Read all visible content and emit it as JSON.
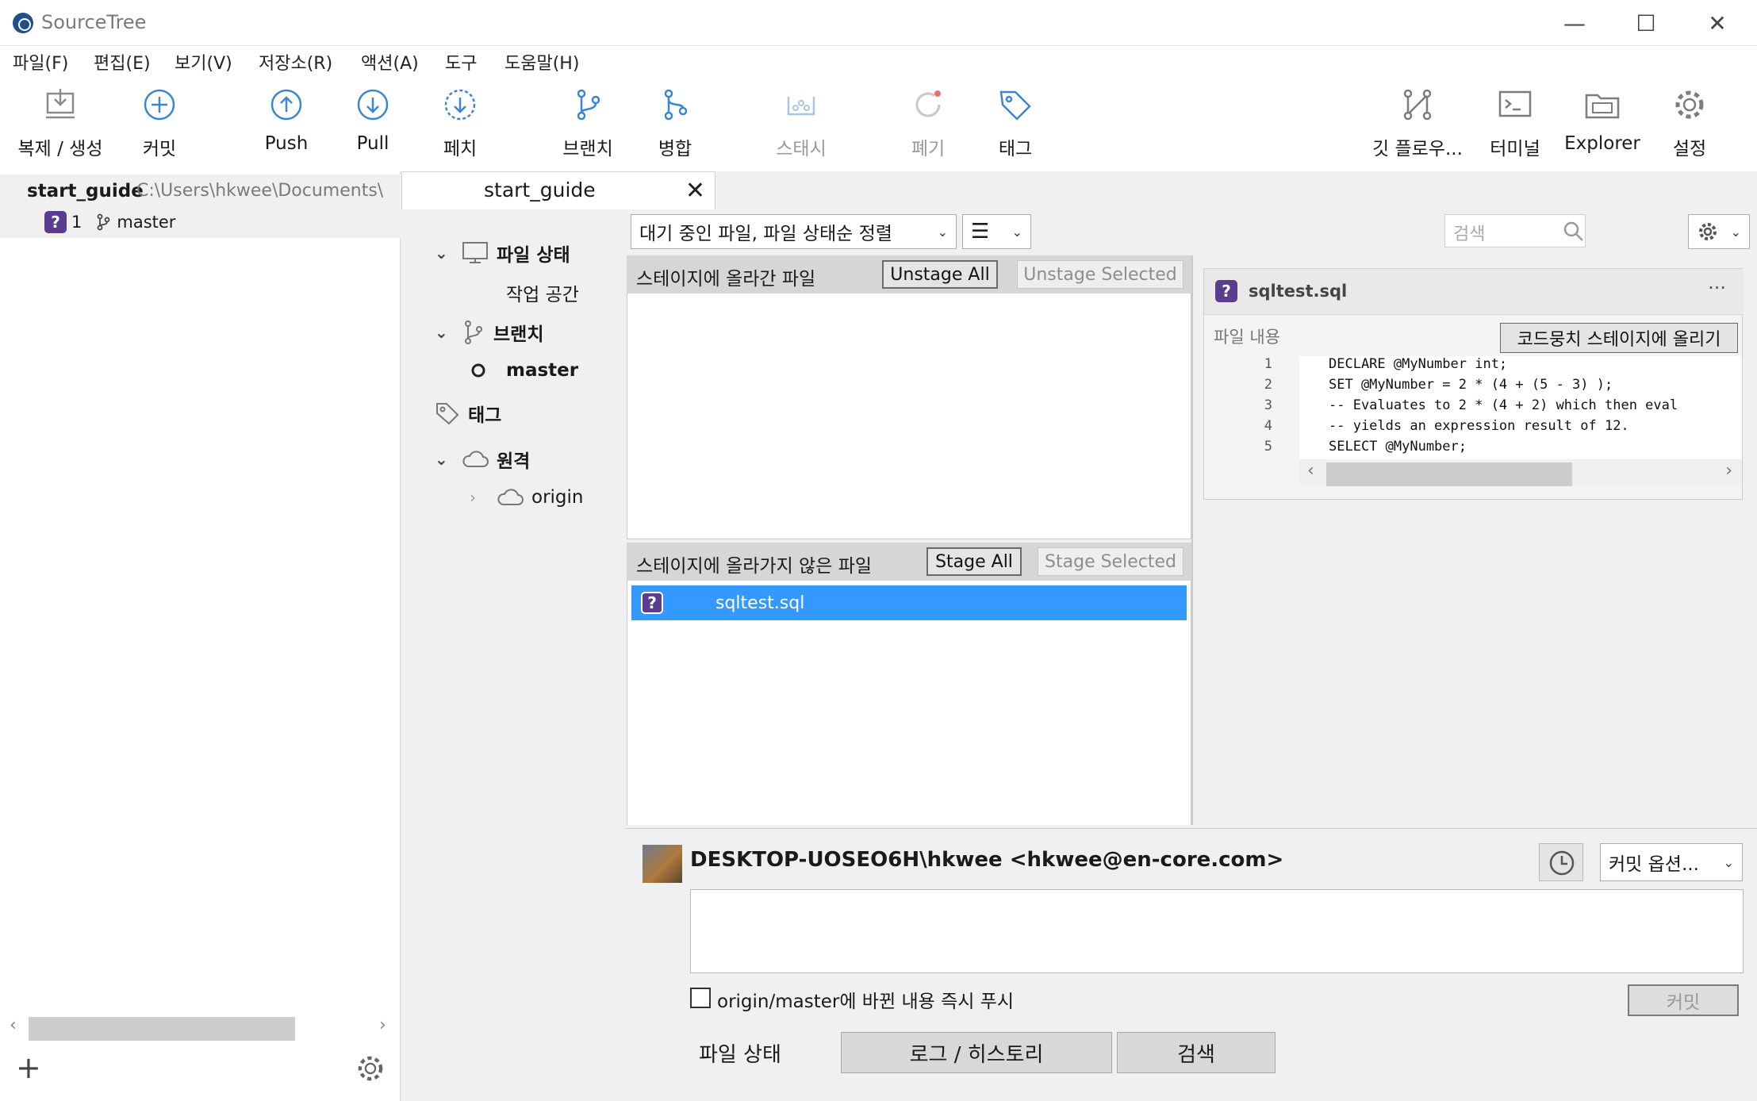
{
  "window": {
    "title": "SourceTree",
    "minimize": "—",
    "maximize": "☐",
    "close": "✕"
  },
  "menu": [
    "파일(F)",
    "편집(E)",
    "보기(V)",
    "저장소(R)",
    "액션(A)",
    "도구",
    "도움말(H)"
  ],
  "toolbar": {
    "clone": "복제 / 생성",
    "commit": "커밋",
    "push": "Push",
    "pull": "Pull",
    "fetch": "페치",
    "branch": "브랜치",
    "merge": "병합",
    "stash": "스태시",
    "discard": "폐기",
    "tag": "태그",
    "git_flow": "깃 플로우...",
    "terminal": "터미널",
    "explorer": "Explorer",
    "settings": "설정"
  },
  "sidebar": {
    "repo_name": "start_guide",
    "repo_path": "C:\\Users\\hkwee\\Documents\\",
    "badge": "?",
    "status_count": "1",
    "branch": "master"
  },
  "repo_tab": {
    "name": "start_guide",
    "close": "✕"
  },
  "nav": {
    "file_status": "파일 상태",
    "workspace": "작업 공간",
    "branches": "브랜치",
    "master": "master",
    "tags": "태그",
    "remotes": "원격",
    "origin": "origin"
  },
  "filter": {
    "sort_label": "대기 중인 파일, 파일 상태순 정렬",
    "search_placeholder": "검색"
  },
  "staged": {
    "title": "스테이지에 올라간 파일",
    "unstage_all": "Unstage All",
    "unstage_selected": "Unstage Selected"
  },
  "unstaged": {
    "title": "스테이지에 올라가지 않은 파일",
    "stage_all": "Stage All",
    "stage_selected": "Stage Selected",
    "files": [
      {
        "badge": "?",
        "name": "sqltest.sql"
      }
    ]
  },
  "diff": {
    "file": "sqltest.sql",
    "badge": "?",
    "more": "···",
    "hunk_label": "파일 내용",
    "stage_hunk": "코드뭉치 스테이지에 올리기",
    "lines": [
      {
        "n": "1",
        "t": "DECLARE @MyNumber int;"
      },
      {
        "n": "2",
        "t": "SET @MyNumber = 2 * (4 + (5 - 3) );"
      },
      {
        "n": "3",
        "t": "-- Evaluates to 2 * (4 + 2) which then eval"
      },
      {
        "n": "4",
        "t": "-- yields an expression result of 12."
      },
      {
        "n": "5",
        "t": "SELECT @MyNumber;"
      }
    ]
  },
  "commit": {
    "author": "DESKTOP-UOSEO6H\\hkwee <hkwee@en-core.com>",
    "options": "커밋 옵션...",
    "push_label": "origin/master에 바뀐 내용 즉시 푸시",
    "button": "커밋"
  },
  "bottom_tabs": {
    "file_status": "파일 상태",
    "log": "로그 / 히스토리",
    "search": "검색"
  }
}
